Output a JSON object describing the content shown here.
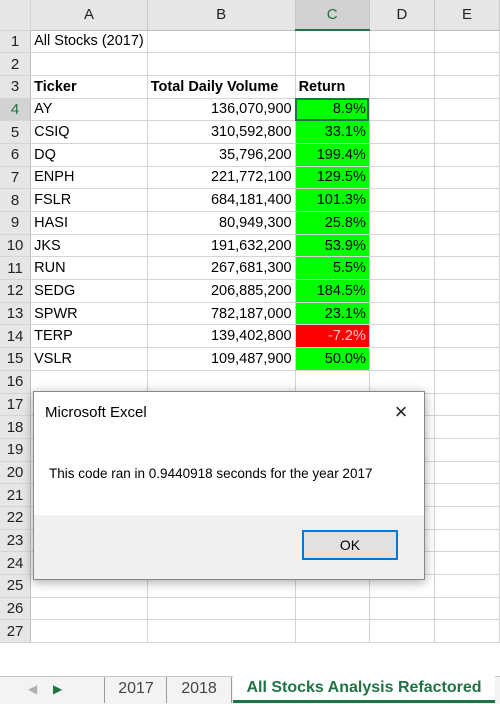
{
  "columns": [
    "A",
    "B",
    "C",
    "D",
    "E"
  ],
  "rows": [
    {
      "n": "1",
      "a": "All Stocks (2017)",
      "b": "",
      "c": ""
    },
    {
      "n": "2",
      "a": "",
      "b": "",
      "c": ""
    },
    {
      "n": "3",
      "a": "Ticker",
      "b": "Total Daily Volume",
      "c": "Return"
    },
    {
      "n": "4",
      "a": "AY",
      "b": "136,070,900",
      "c": "8.9%"
    },
    {
      "n": "5",
      "a": "CSIQ",
      "b": "310,592,800",
      "c": "33.1%"
    },
    {
      "n": "6",
      "a": "DQ",
      "b": "35,796,200",
      "c": "199.4%"
    },
    {
      "n": "7",
      "a": "ENPH",
      "b": "221,772,100",
      "c": "129.5%"
    },
    {
      "n": "8",
      "a": "FSLR",
      "b": "684,181,400",
      "c": "101.3%"
    },
    {
      "n": "9",
      "a": "HASI",
      "b": "80,949,300",
      "c": "25.8%"
    },
    {
      "n": "10",
      "a": "JKS",
      "b": "191,632,200",
      "c": "53.9%"
    },
    {
      "n": "11",
      "a": "RUN",
      "b": "267,681,300",
      "c": "5.5%"
    },
    {
      "n": "12",
      "a": "SEDG",
      "b": "206,885,200",
      "c": "184.5%"
    },
    {
      "n": "13",
      "a": "SPWR",
      "b": "782,187,000",
      "c": "23.1%"
    },
    {
      "n": "14",
      "a": "TERP",
      "b": "139,402,800",
      "c": "-7.2%"
    },
    {
      "n": "15",
      "a": "VSLR",
      "b": "109,487,900",
      "c": "50.0%"
    },
    {
      "n": "16",
      "a": "",
      "b": "",
      "c": ""
    },
    {
      "n": "17",
      "a": "",
      "b": "",
      "c": ""
    },
    {
      "n": "18",
      "a": "",
      "b": "",
      "c": ""
    },
    {
      "n": "19",
      "a": "",
      "b": "",
      "c": ""
    },
    {
      "n": "20",
      "a": "",
      "b": "",
      "c": ""
    },
    {
      "n": "21",
      "a": "",
      "b": "",
      "c": ""
    },
    {
      "n": "22",
      "a": "",
      "b": "",
      "c": ""
    },
    {
      "n": "23",
      "a": "",
      "b": "",
      "c": ""
    },
    {
      "n": "24",
      "a": "",
      "b": "",
      "c": ""
    },
    {
      "n": "25",
      "a": "",
      "b": "",
      "c": ""
    },
    {
      "n": "26",
      "a": "",
      "b": "",
      "c": ""
    },
    {
      "n": "27",
      "a": "",
      "b": "",
      "c": ""
    }
  ],
  "colors": {
    "positive_fill": "#00ff00",
    "negative_fill": "#ff0000",
    "excel_green": "#217346"
  },
  "dialog": {
    "title": "Microsoft Excel",
    "message": "This code ran in 0.9440918 seconds for the year 2017",
    "ok_label": "OK",
    "close_icon": "×"
  },
  "tabs": {
    "prev_icon": "◀",
    "next_icon": "▶",
    "items": [
      "2017",
      "2018",
      "All Stocks Analysis Refactored"
    ]
  }
}
